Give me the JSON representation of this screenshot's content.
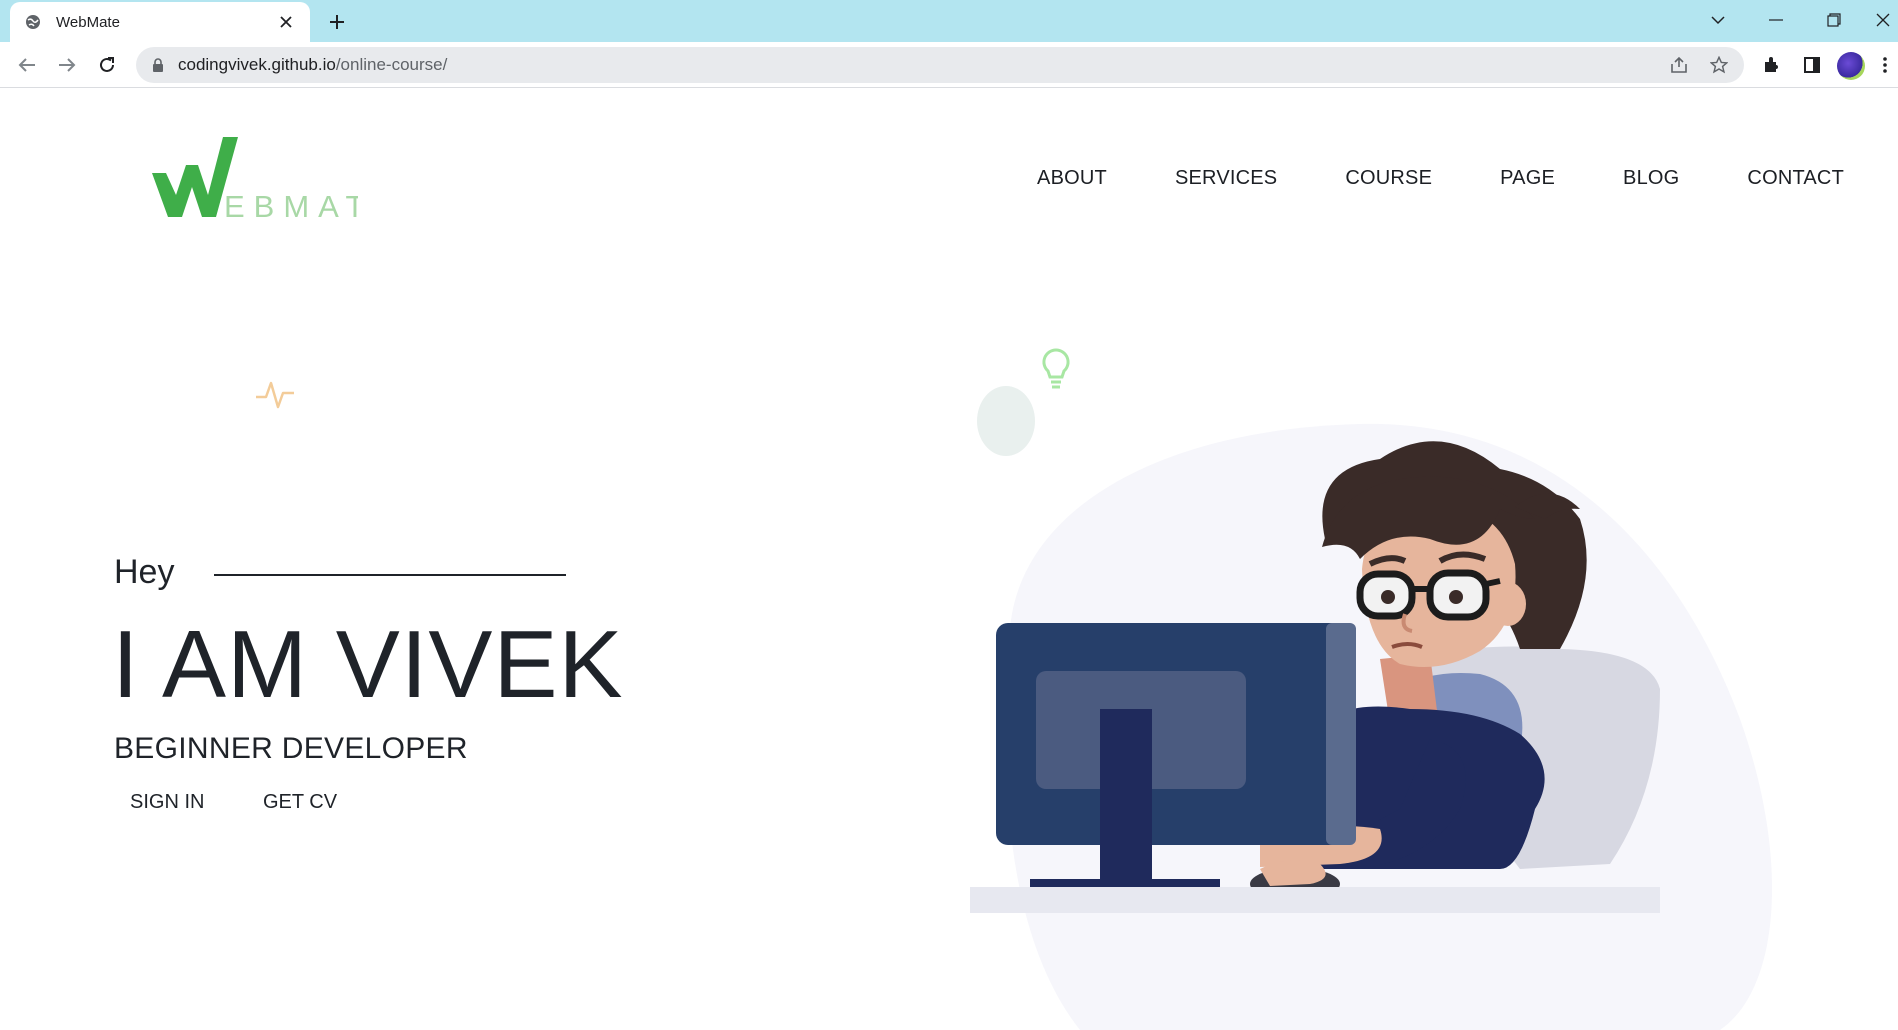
{
  "browser": {
    "tab_title": "WebMate",
    "url_host": "codingvivek.github.io",
    "url_path": "/online-course/"
  },
  "site": {
    "logo_letter": "W",
    "logo_rest": "EBMATE",
    "nav": [
      "ABOUT",
      "SERVICES",
      "COURSE",
      "PAGE",
      "BLOG",
      "CONTACT"
    ]
  },
  "hero": {
    "greeting": "Hey",
    "headline": "I AM VIVEK",
    "subtitle": "BEGINNER DEVELOPER",
    "sign_in": "SIGN IN",
    "get_cv": "GET CV"
  },
  "colors": {
    "tabstrip": "#b3e5f0",
    "logo_green": "#3fae49",
    "logo_light": "#a8d8a6",
    "text_dark": "#1f2329",
    "monitor": "#263f6a",
    "shirt": "#1f2a5c",
    "hair": "#3a2b28"
  },
  "icons": {
    "tab_favicon": "globe-icon",
    "heartbeat": "heartbeat-icon",
    "bulb": "lightbulb-icon"
  }
}
